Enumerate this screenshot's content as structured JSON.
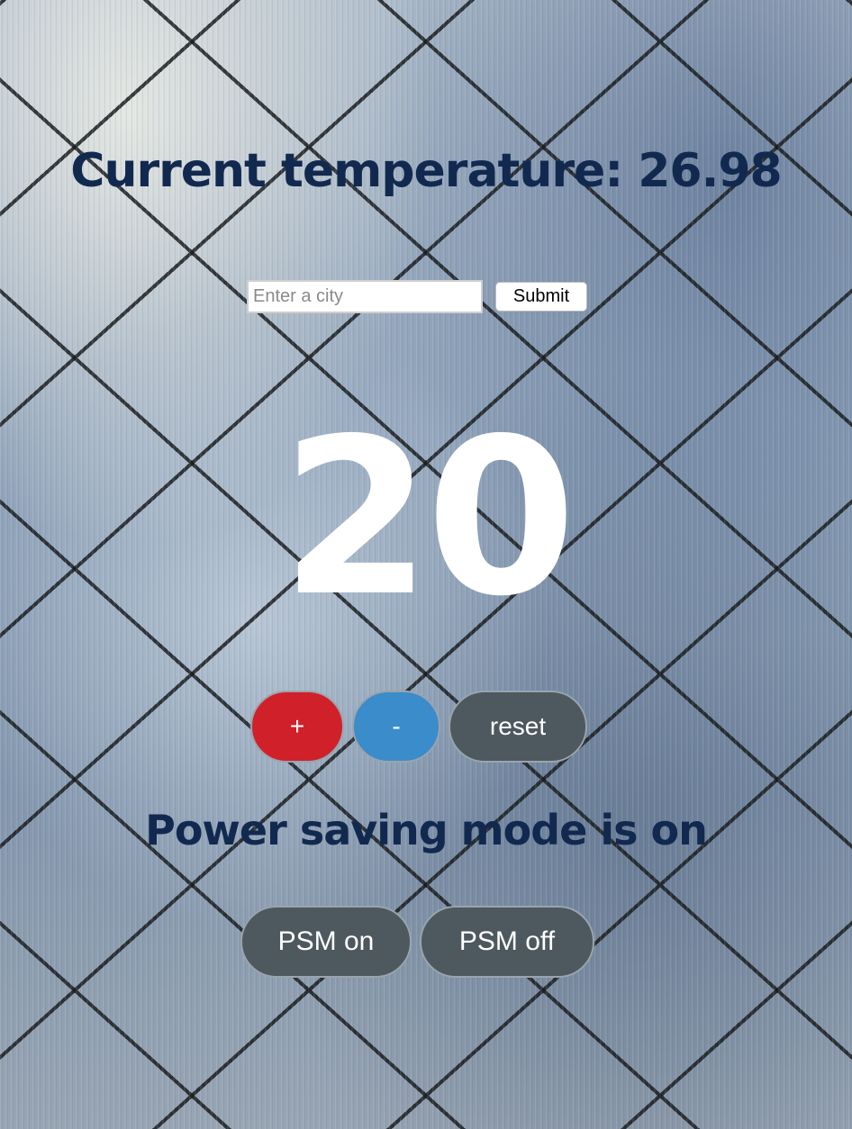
{
  "header": {
    "title": "Current temperature: 26.98"
  },
  "city_form": {
    "placeholder": "Enter a city",
    "value": "",
    "submit_label": "Submit"
  },
  "thermostat": {
    "temperature": "20",
    "increase_label": "+",
    "decrease_label": "-",
    "reset_label": "reset"
  },
  "power_saving": {
    "status_text": "Power saving mode is on",
    "on_label": "PSM on",
    "off_label": "PSM off"
  },
  "colors": {
    "heading": "#12294f",
    "increase_button": "#d0202a",
    "decrease_button": "#3a8ccb",
    "neutral_button": "#4e585f",
    "temperature_text": "#ffffff"
  }
}
